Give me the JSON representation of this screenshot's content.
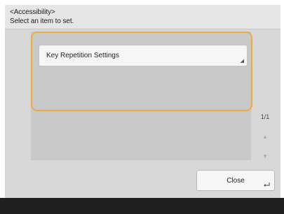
{
  "header": {
    "title": "<Accessibility>",
    "instruction": "Select an item to set."
  },
  "items": [
    {
      "label": "Key Repetition Settings"
    }
  ],
  "pager": {
    "page_indicator": "1/1"
  },
  "actions": {
    "close_label": "Close"
  },
  "colors": {
    "highlight": "#f3a93a",
    "panel": "#c9c9c9",
    "background": "#d8d8d8"
  }
}
